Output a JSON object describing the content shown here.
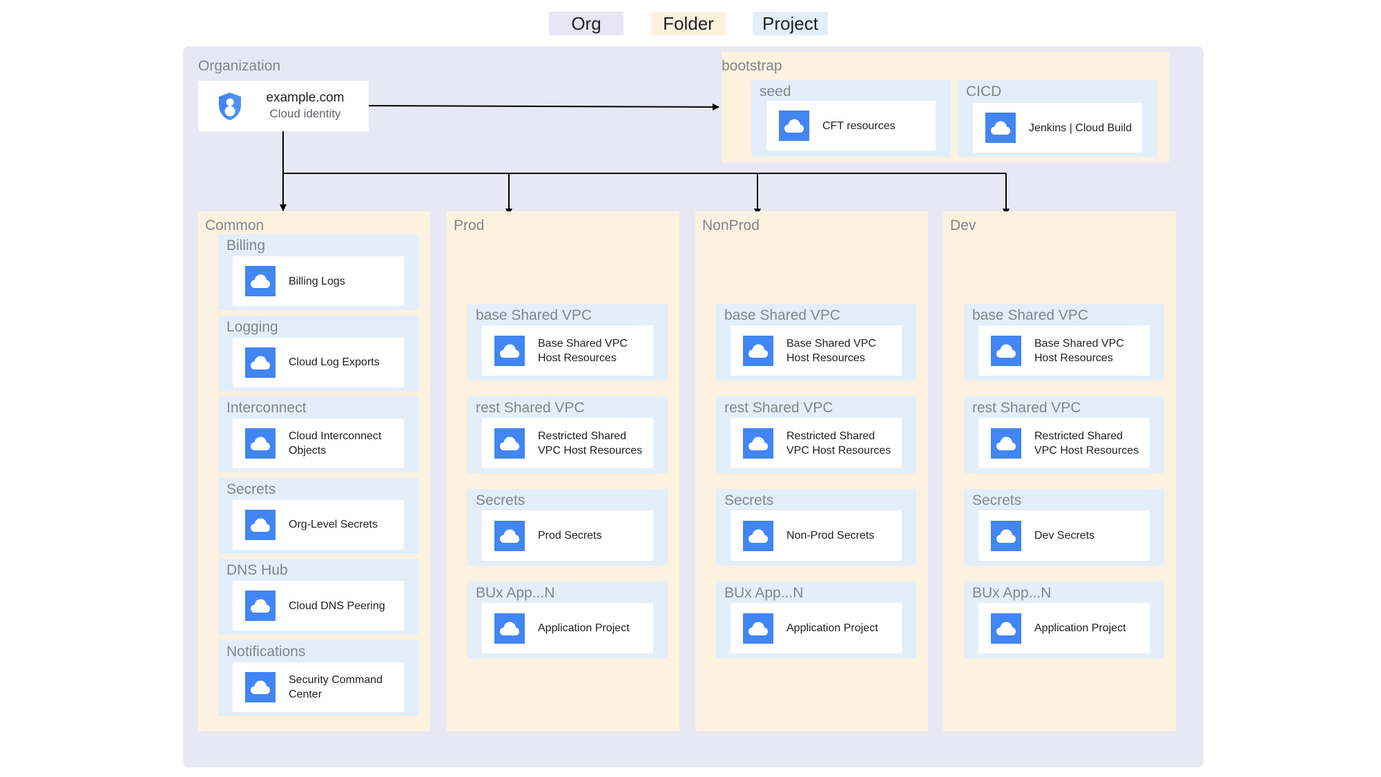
{
  "legend": [
    {
      "label": "Org",
      "color": "#e8e6f5"
    },
    {
      "label": "Folder",
      "color": "#fdf1e0"
    },
    {
      "label": "Project",
      "color": "#e2effb"
    }
  ],
  "colors": {
    "org_bg": "#e8e8f4",
    "folder_bg": "#fdf1e0",
    "project_bg": "#e2effb",
    "icon_blue": "#4285f4",
    "label_gray": "#80868b"
  },
  "organization": {
    "label": "Organization",
    "domain": "example.com",
    "subtitle": "Cloud identity",
    "icon": "cloud-identity-shield-icon"
  },
  "bootstrap": {
    "label": "bootstrap",
    "projects": [
      {
        "label": "seed",
        "resource": "CFT resources",
        "icon": "cloud-icon"
      },
      {
        "label": "CICD",
        "resource": "Jenkins | Cloud Build",
        "icon": "cloud-icon"
      }
    ]
  },
  "common": {
    "label": "Common",
    "projects": [
      {
        "label": "Billing",
        "resource": "Billing Logs"
      },
      {
        "label": "Logging",
        "resource": "Cloud Log Exports"
      },
      {
        "label": "Interconnect",
        "resource": "Cloud Interconnect\nObjects"
      },
      {
        "label": "Secrets",
        "resource": "Org-Level Secrets"
      },
      {
        "label": "DNS Hub",
        "resource": "Cloud DNS Peering"
      },
      {
        "label": "Notifications",
        "resource": "Security Command\nCenter"
      }
    ]
  },
  "environments": [
    {
      "label": "Prod",
      "projects": [
        {
          "label": "base Shared VPC",
          "resource": "Base Shared VPC\nHost Resources"
        },
        {
          "label": "rest Shared VPC",
          "resource": "Restricted Shared\nVPC Host Resources"
        },
        {
          "label": "Secrets",
          "resource": "Prod Secrets"
        },
        {
          "label": "BUx App...N",
          "resource": "Application Project"
        }
      ]
    },
    {
      "label": "NonProd",
      "projects": [
        {
          "label": "base Shared VPC",
          "resource": "Base Shared VPC\nHost Resources"
        },
        {
          "label": "rest Shared VPC",
          "resource": "Restricted Shared\nVPC Host Resources"
        },
        {
          "label": "Secrets",
          "resource": "Non-Prod Secrets"
        },
        {
          "label": "BUx App...N",
          "resource": "Application Project"
        }
      ]
    },
    {
      "label": "Dev",
      "projects": [
        {
          "label": "base Shared VPC",
          "resource": "Base Shared VPC\nHost Resources"
        },
        {
          "label": "rest Shared VPC",
          "resource": "Restricted Shared\nVPC Host Resources"
        },
        {
          "label": "Secrets",
          "resource": "Dev Secrets"
        },
        {
          "label": "BUx App...N",
          "resource": "Application Project"
        }
      ]
    }
  ]
}
